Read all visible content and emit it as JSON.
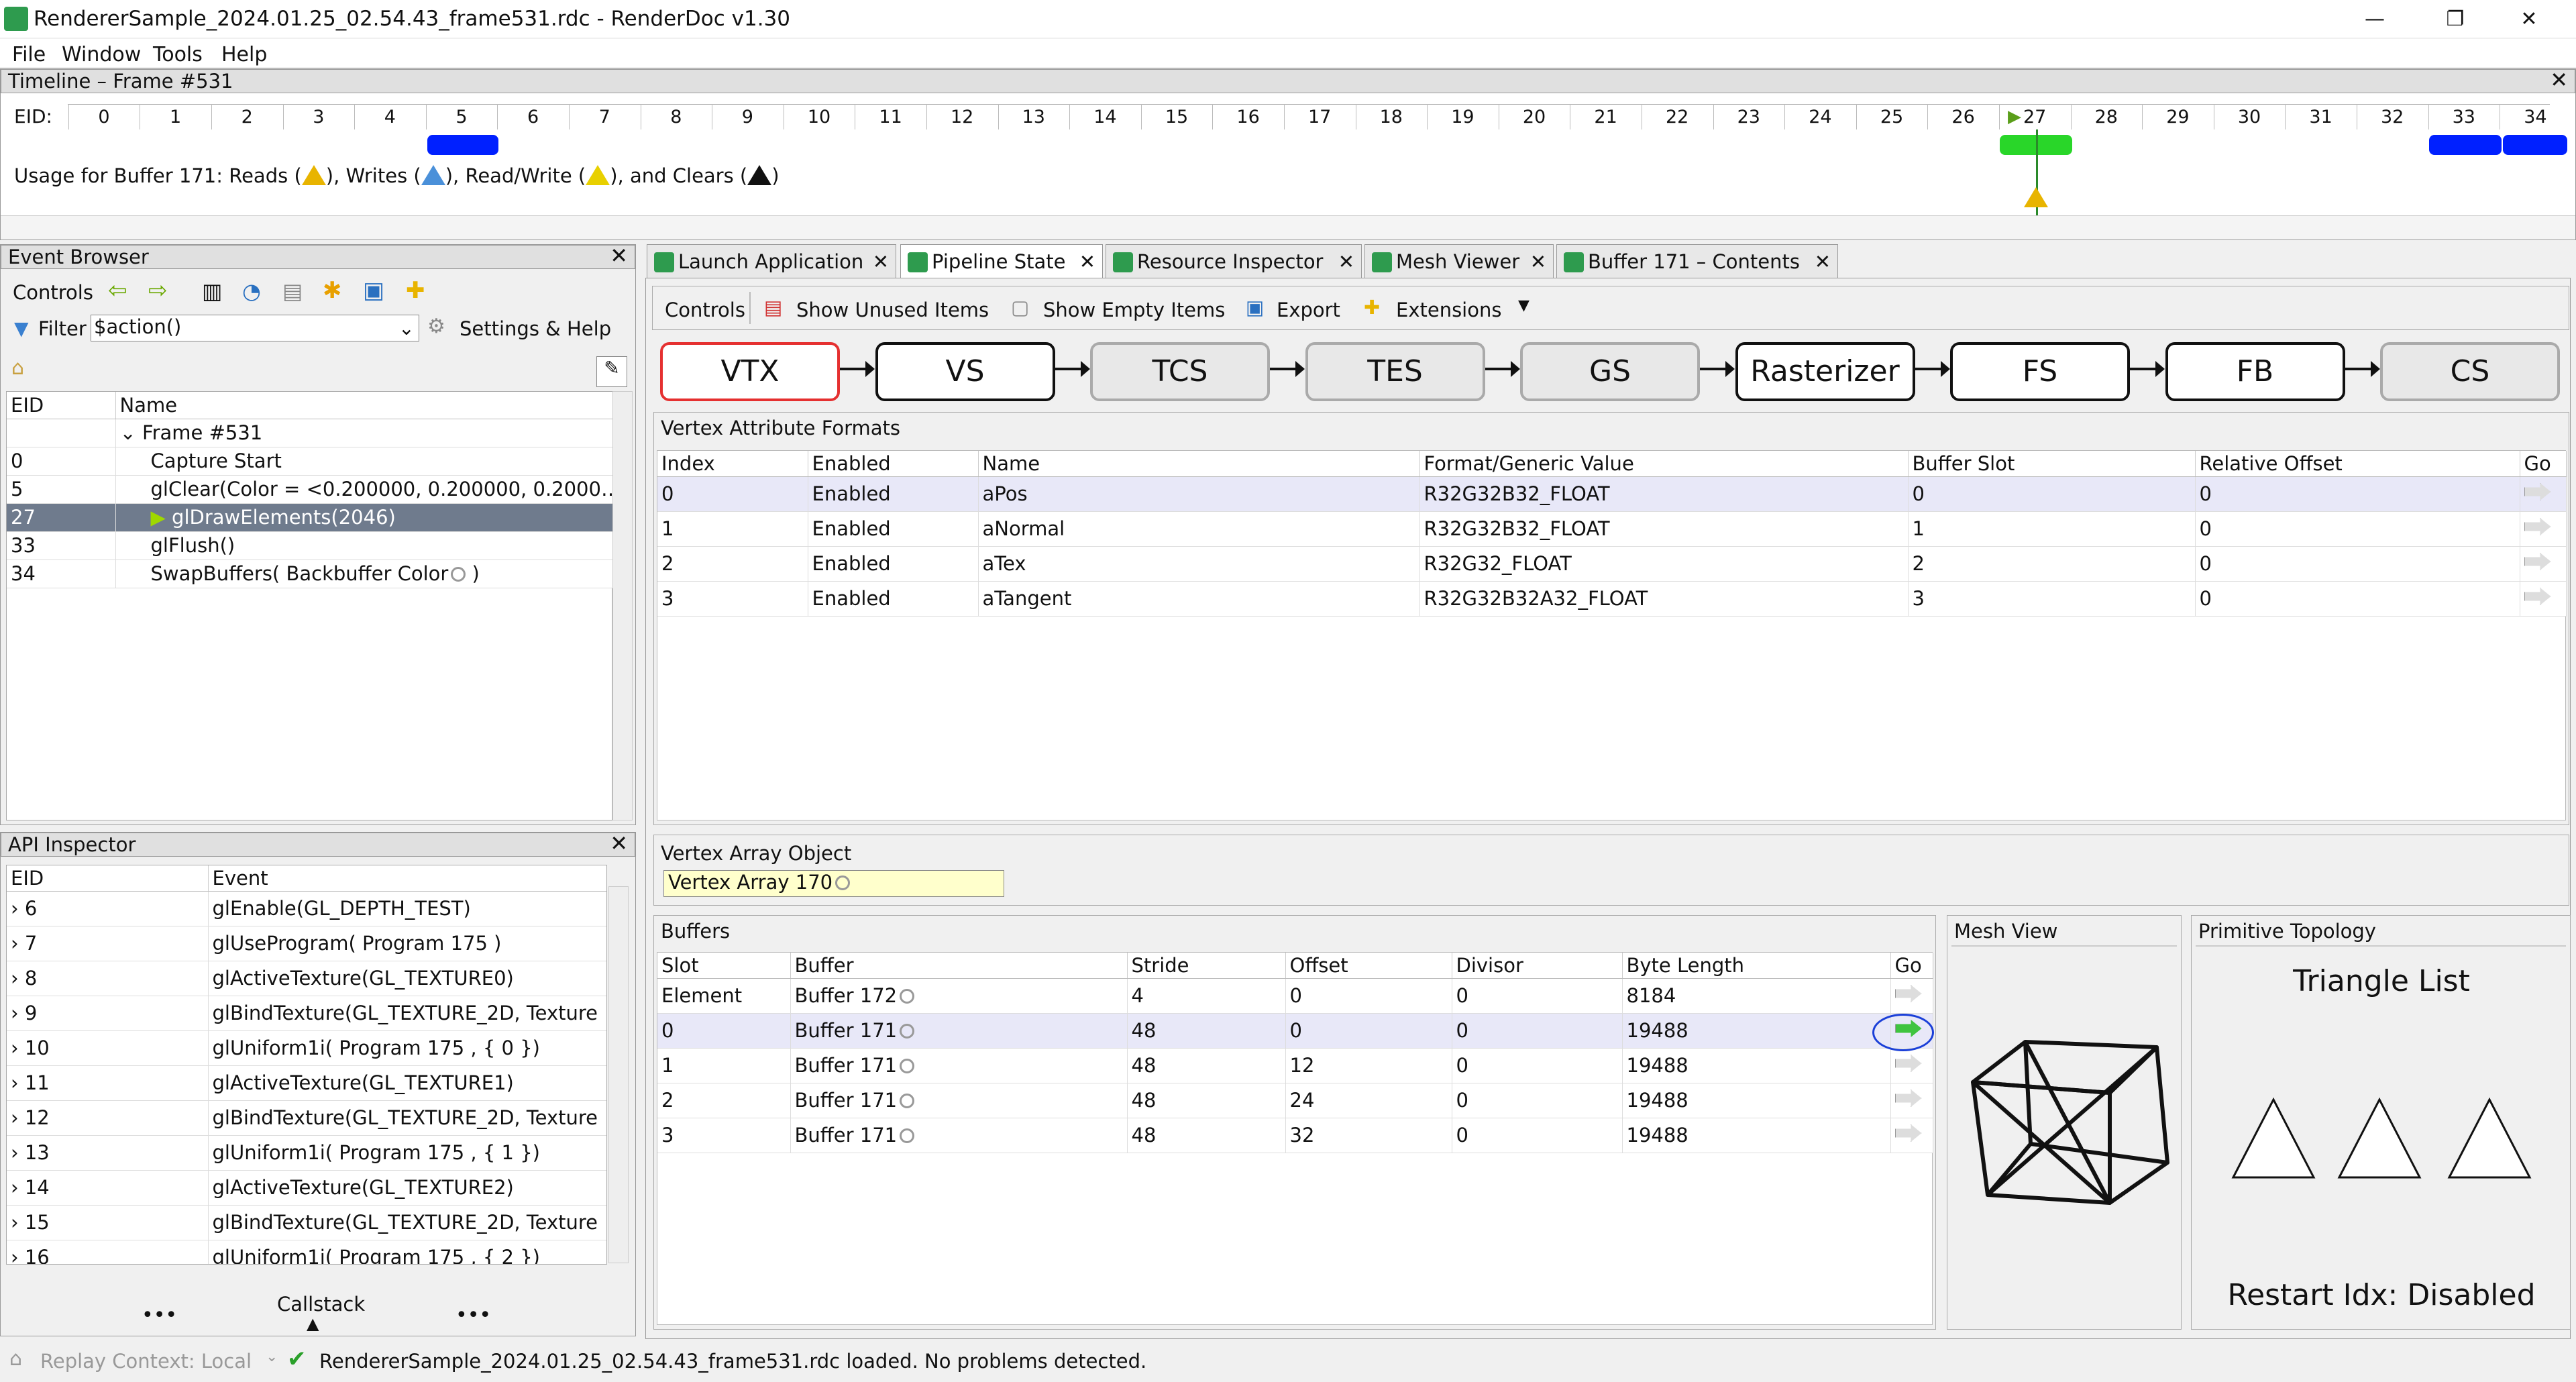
{
  "window": {
    "title": "RendererSample_2024.01.25_02.54.43_frame531.rdc - RenderDoc v1.30",
    "min": "—",
    "restore": "❐",
    "close": "✕"
  },
  "menu": [
    "File",
    "Window",
    "Tools",
    "Help"
  ],
  "timeline": {
    "title": "Timeline – Frame #531",
    "eid_label": "EID:",
    "ticks": [
      "0",
      "1",
      "2",
      "3",
      "4",
      "5",
      "6",
      "7",
      "8",
      "9",
      "10",
      "11",
      "12",
      "13",
      "14",
      "15",
      "16",
      "17",
      "18",
      "19",
      "20",
      "21",
      "22",
      "23",
      "24",
      "25",
      "26",
      "27",
      "28",
      "29",
      "30",
      "31",
      "32",
      "33",
      "34"
    ],
    "usage_prefix": "Usage for Buffer 171: Reads (",
    "usage_writes": "), Writes (",
    "usage_rw": "), Read/Write (",
    "usage_clears": "), and Clears (",
    "usage_end": ")",
    "colors": {
      "reads": "#e8b400",
      "writes": "#4a90d9",
      "rw": "#e8d000",
      "clears": "#111111"
    }
  },
  "event_browser": {
    "title": "Event Browser",
    "controls_label": "Controls",
    "filter_label": "Filter",
    "filter_value": "$action()",
    "settings_label": "Settings & Help",
    "col_eid": "EID",
    "col_name": "Name",
    "rows": [
      {
        "eid": "",
        "name": "Frame #531"
      },
      {
        "eid": "0",
        "name": "Capture Start"
      },
      {
        "eid": "5",
        "name": "glClear(Color = <0.200000, 0.200000, 0.2000…"
      },
      {
        "eid": "27",
        "name": "glDrawElements(2046)"
      },
      {
        "eid": "33",
        "name": "glFlush()"
      },
      {
        "eid": "34",
        "name": "SwapBuffers( Backbuffer Color"
      }
    ],
    "swap_suffix": " )"
  },
  "api_inspector": {
    "title": "API Inspector",
    "col_eid": "EID",
    "col_event": "Event",
    "rows": [
      {
        "eid": "6",
        "event": "glEnable(GL_DEPTH_TEST)"
      },
      {
        "eid": "7",
        "event": "glUseProgram( Program 175 )"
      },
      {
        "eid": "8",
        "event": "glActiveTexture(GL_TEXTURE0)"
      },
      {
        "eid": "9",
        "event": "glBindTexture(GL_TEXTURE_2D,  Texture"
      },
      {
        "eid": "10",
        "event": "glUniform1i( Program 175 , { 0 })"
      },
      {
        "eid": "11",
        "event": "glActiveTexture(GL_TEXTURE1)"
      },
      {
        "eid": "12",
        "event": "glBindTexture(GL_TEXTURE_2D,  Texture"
      },
      {
        "eid": "13",
        "event": "glUniform1i( Program 175 , { 1 })"
      },
      {
        "eid": "14",
        "event": "glActiveTexture(GL_TEXTURE2)"
      },
      {
        "eid": "15",
        "event": "glBindTexture(GL_TEXTURE_2D,  Texture"
      },
      {
        "eid": "16",
        "event": "glUniform1i( Program 175 , { 2 })"
      }
    ],
    "dots_left": "•••",
    "callstack": "Callstack",
    "dots_right": "•••"
  },
  "tabs": [
    {
      "label": "Launch Application"
    },
    {
      "label": "Pipeline State"
    },
    {
      "label": "Resource Inspector"
    },
    {
      "label": "Mesh Viewer"
    },
    {
      "label": "Buffer 171 – Contents"
    }
  ],
  "pipeline_toolbar": {
    "controls": "Controls",
    "show_unused": "Show Unused Items",
    "show_empty": "Show Empty Items",
    "export": "Export",
    "extensions": "Extensions"
  },
  "stages": [
    "VTX",
    "VS",
    "TCS",
    "TES",
    "GS",
    "Rasterizer",
    "FS",
    "FB",
    "CS"
  ],
  "vertex_attributes": {
    "title": "Vertex Attribute Formats",
    "columns": [
      "Index",
      "Enabled",
      "Name",
      "Format/Generic Value",
      "Buffer Slot",
      "Relative Offset",
      "Go"
    ],
    "rows": [
      [
        "0",
        "Enabled",
        "aPos",
        "R32G32B32_FLOAT",
        "0",
        "0"
      ],
      [
        "1",
        "Enabled",
        "aNormal",
        "R32G32B32_FLOAT",
        "1",
        "0"
      ],
      [
        "2",
        "Enabled",
        "aTex",
        "R32G32_FLOAT",
        "2",
        "0"
      ],
      [
        "3",
        "Enabled",
        "aTangent",
        "R32G32B32A32_FLOAT",
        "3",
        "0"
      ]
    ]
  },
  "vao": {
    "title": "Vertex Array Object",
    "value": "Vertex Array 170"
  },
  "buffers": {
    "title": "Buffers",
    "columns": [
      "Slot",
      "Buffer",
      "Stride",
      "Offset",
      "Divisor",
      "Byte Length",
      "Go"
    ],
    "rows": [
      [
        "Element",
        "Buffer 172",
        "4",
        "0",
        "0",
        "8184"
      ],
      [
        "0",
        "Buffer 171",
        "48",
        "0",
        "0",
        "19488"
      ],
      [
        "1",
        "Buffer 171",
        "48",
        "12",
        "0",
        "19488"
      ],
      [
        "2",
        "Buffer 171",
        "48",
        "24",
        "0",
        "19488"
      ],
      [
        "3",
        "Buffer 171",
        "48",
        "32",
        "0",
        "19488"
      ]
    ]
  },
  "mesh_view": {
    "title": "Mesh View"
  },
  "topology": {
    "title": "Primitive Topology",
    "value": "Triangle List",
    "restart": "Restart Idx: Disabled"
  },
  "status": {
    "context": "Replay Context: Local",
    "message": "RendererSample_2024.01.25_02.54.43_frame531.rdc loaded. No problems detected."
  }
}
